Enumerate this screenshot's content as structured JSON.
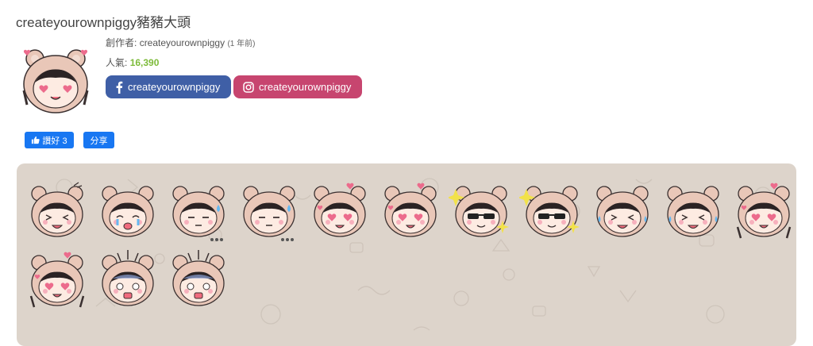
{
  "header": {
    "title": "createyourownpiggy豬豬大頭"
  },
  "author": {
    "label": "創作者:",
    "name": "createyourownpiggy",
    "age": "(1 年前)"
  },
  "popularity": {
    "label": "人氣:",
    "value": "16,390"
  },
  "social": {
    "facebook_label": "createyourownpiggy",
    "instagram_label": "createyourownpiggy"
  },
  "actions": {
    "like_label": "讚好 3",
    "share_label": "分享"
  },
  "colors": {
    "facebook": "#3f5fa6",
    "instagram": "#c7456f",
    "like_button": "#1877f2",
    "popularity": "#7dbb3a",
    "panel": "#ddd4cb"
  },
  "stickers": [
    {
      "icon": "piggy-squint-angry-sticker"
    },
    {
      "icon": "piggy-crying-sticker"
    },
    {
      "icon": "piggy-sweat-dots-sticker"
    },
    {
      "icon": "piggy-sweat-dots-sticker-2"
    },
    {
      "icon": "piggy-heart-eyes-sticker"
    },
    {
      "icon": "piggy-heart-eyes-sticker-2"
    },
    {
      "icon": "piggy-sunglasses-sticker"
    },
    {
      "icon": "piggy-sunglasses-sticker-2"
    },
    {
      "icon": "piggy-laughing-tears-sticker"
    },
    {
      "icon": "piggy-laughing-tears-sticker-2"
    },
    {
      "icon": "piggy-heart-eyes-chopsticks-sticker"
    },
    {
      "icon": "piggy-heart-eyes-chopsticks-sticker-2"
    },
    {
      "icon": "piggy-shocked-sticker"
    },
    {
      "icon": "piggy-shocked-sticker-2"
    }
  ]
}
